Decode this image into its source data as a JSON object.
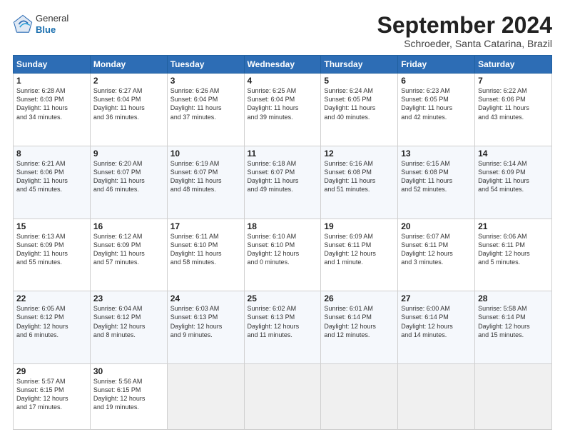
{
  "header": {
    "logo_line1": "General",
    "logo_line2": "Blue",
    "title": "September 2024",
    "subtitle": "Schroeder, Santa Catarina, Brazil"
  },
  "weekdays": [
    "Sunday",
    "Monday",
    "Tuesday",
    "Wednesday",
    "Thursday",
    "Friday",
    "Saturday"
  ],
  "weeks": [
    [
      {
        "day": "1",
        "info": "Sunrise: 6:28 AM\nSunset: 6:03 PM\nDaylight: 11 hours\nand 34 minutes."
      },
      {
        "day": "2",
        "info": "Sunrise: 6:27 AM\nSunset: 6:04 PM\nDaylight: 11 hours\nand 36 minutes."
      },
      {
        "day": "3",
        "info": "Sunrise: 6:26 AM\nSunset: 6:04 PM\nDaylight: 11 hours\nand 37 minutes."
      },
      {
        "day": "4",
        "info": "Sunrise: 6:25 AM\nSunset: 6:04 PM\nDaylight: 11 hours\nand 39 minutes."
      },
      {
        "day": "5",
        "info": "Sunrise: 6:24 AM\nSunset: 6:05 PM\nDaylight: 11 hours\nand 40 minutes."
      },
      {
        "day": "6",
        "info": "Sunrise: 6:23 AM\nSunset: 6:05 PM\nDaylight: 11 hours\nand 42 minutes."
      },
      {
        "day": "7",
        "info": "Sunrise: 6:22 AM\nSunset: 6:06 PM\nDaylight: 11 hours\nand 43 minutes."
      }
    ],
    [
      {
        "day": "8",
        "info": "Sunrise: 6:21 AM\nSunset: 6:06 PM\nDaylight: 11 hours\nand 45 minutes."
      },
      {
        "day": "9",
        "info": "Sunrise: 6:20 AM\nSunset: 6:07 PM\nDaylight: 11 hours\nand 46 minutes."
      },
      {
        "day": "10",
        "info": "Sunrise: 6:19 AM\nSunset: 6:07 PM\nDaylight: 11 hours\nand 48 minutes."
      },
      {
        "day": "11",
        "info": "Sunrise: 6:18 AM\nSunset: 6:07 PM\nDaylight: 11 hours\nand 49 minutes."
      },
      {
        "day": "12",
        "info": "Sunrise: 6:16 AM\nSunset: 6:08 PM\nDaylight: 11 hours\nand 51 minutes."
      },
      {
        "day": "13",
        "info": "Sunrise: 6:15 AM\nSunset: 6:08 PM\nDaylight: 11 hours\nand 52 minutes."
      },
      {
        "day": "14",
        "info": "Sunrise: 6:14 AM\nSunset: 6:09 PM\nDaylight: 11 hours\nand 54 minutes."
      }
    ],
    [
      {
        "day": "15",
        "info": "Sunrise: 6:13 AM\nSunset: 6:09 PM\nDaylight: 11 hours\nand 55 minutes."
      },
      {
        "day": "16",
        "info": "Sunrise: 6:12 AM\nSunset: 6:09 PM\nDaylight: 11 hours\nand 57 minutes."
      },
      {
        "day": "17",
        "info": "Sunrise: 6:11 AM\nSunset: 6:10 PM\nDaylight: 11 hours\nand 58 minutes."
      },
      {
        "day": "18",
        "info": "Sunrise: 6:10 AM\nSunset: 6:10 PM\nDaylight: 12 hours\nand 0 minutes."
      },
      {
        "day": "19",
        "info": "Sunrise: 6:09 AM\nSunset: 6:11 PM\nDaylight: 12 hours\nand 1 minute."
      },
      {
        "day": "20",
        "info": "Sunrise: 6:07 AM\nSunset: 6:11 PM\nDaylight: 12 hours\nand 3 minutes."
      },
      {
        "day": "21",
        "info": "Sunrise: 6:06 AM\nSunset: 6:11 PM\nDaylight: 12 hours\nand 5 minutes."
      }
    ],
    [
      {
        "day": "22",
        "info": "Sunrise: 6:05 AM\nSunset: 6:12 PM\nDaylight: 12 hours\nand 6 minutes."
      },
      {
        "day": "23",
        "info": "Sunrise: 6:04 AM\nSunset: 6:12 PM\nDaylight: 12 hours\nand 8 minutes."
      },
      {
        "day": "24",
        "info": "Sunrise: 6:03 AM\nSunset: 6:13 PM\nDaylight: 12 hours\nand 9 minutes."
      },
      {
        "day": "25",
        "info": "Sunrise: 6:02 AM\nSunset: 6:13 PM\nDaylight: 12 hours\nand 11 minutes."
      },
      {
        "day": "26",
        "info": "Sunrise: 6:01 AM\nSunset: 6:14 PM\nDaylight: 12 hours\nand 12 minutes."
      },
      {
        "day": "27",
        "info": "Sunrise: 6:00 AM\nSunset: 6:14 PM\nDaylight: 12 hours\nand 14 minutes."
      },
      {
        "day": "28",
        "info": "Sunrise: 5:58 AM\nSunset: 6:14 PM\nDaylight: 12 hours\nand 15 minutes."
      }
    ],
    [
      {
        "day": "29",
        "info": "Sunrise: 5:57 AM\nSunset: 6:15 PM\nDaylight: 12 hours\nand 17 minutes."
      },
      {
        "day": "30",
        "info": "Sunrise: 5:56 AM\nSunset: 6:15 PM\nDaylight: 12 hours\nand 19 minutes."
      },
      {
        "day": "",
        "info": ""
      },
      {
        "day": "",
        "info": ""
      },
      {
        "day": "",
        "info": ""
      },
      {
        "day": "",
        "info": ""
      },
      {
        "day": "",
        "info": ""
      }
    ]
  ]
}
